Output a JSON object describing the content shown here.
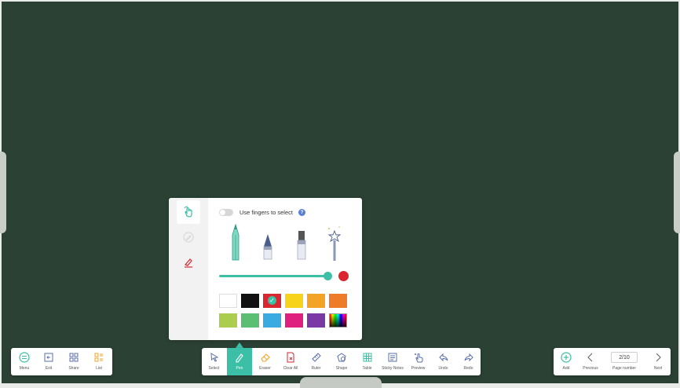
{
  "colors": {
    "board": "#2b4134",
    "accent": "#3bbfa6",
    "current_color": "#d9262f"
  },
  "pen_panel": {
    "modes": [
      "select-hand-icon",
      "pen-icon-disabled",
      "eraser-icon-red"
    ],
    "use_fingers_label": "Use fingers to select",
    "use_fingers_enabled": false,
    "pen_types": [
      "marker-pen-icon",
      "brush-pen-icon",
      "highlighter-pen-icon",
      "magic-wand-pen-icon"
    ],
    "thickness_level": 1.0,
    "swatches": [
      "#ffffff",
      "#111111",
      "#d9262f",
      "#f7d41b",
      "#f3a325",
      "#ee7b28",
      "#aacd4d",
      "#5abf72",
      "#3aabe1",
      "#e0207e",
      "#7b39a5",
      "rainbow"
    ],
    "selected_swatch_index": 2
  },
  "left_toolbar": {
    "items": [
      {
        "label": "Menu",
        "icon": "menu-icon"
      },
      {
        "label": "Exit",
        "icon": "exit-icon"
      },
      {
        "label": "Share",
        "icon": "share-icon"
      },
      {
        "label": "List",
        "icon": "list-icon"
      }
    ]
  },
  "center_toolbar": {
    "items": [
      {
        "label": "Select",
        "icon": "select-icon"
      },
      {
        "label": "Pen",
        "icon": "pen-icon"
      },
      {
        "label": "Eraser",
        "icon": "eraser-icon"
      },
      {
        "label": "Clear All",
        "icon": "clear-all-icon"
      },
      {
        "label": "Ruler",
        "icon": "ruler-icon"
      },
      {
        "label": "Shape",
        "icon": "shape-icon"
      },
      {
        "label": "Table",
        "icon": "table-icon"
      },
      {
        "label": "Sticky Notes",
        "icon": "sticky-notes-icon"
      },
      {
        "label": "Preview",
        "icon": "preview-icon"
      },
      {
        "label": "Undo",
        "icon": "undo-icon"
      },
      {
        "label": "Redo",
        "icon": "redo-icon"
      }
    ],
    "active_index": 1
  },
  "right_toolbar": {
    "add_label": "Add",
    "previous_label": "Previous",
    "page_number_label": "Page number",
    "page_value": "2/10",
    "next_label": "Next"
  }
}
